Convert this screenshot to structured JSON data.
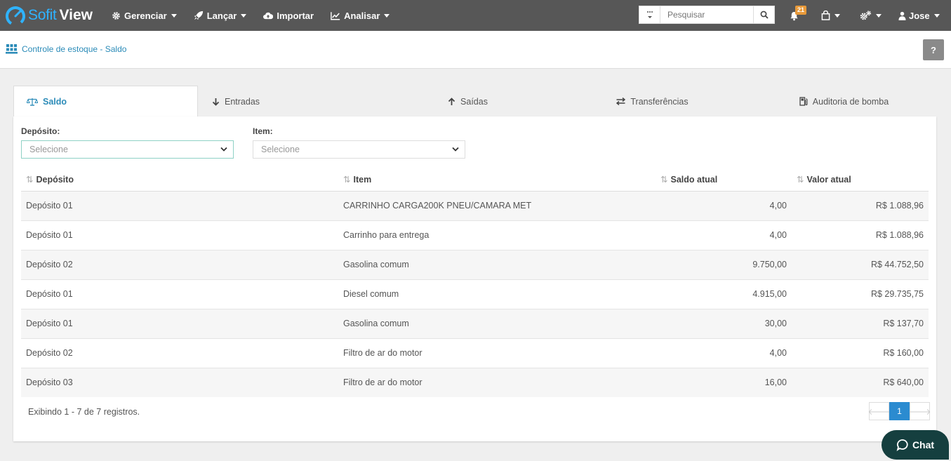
{
  "app": {
    "logo_part1": "Sofit",
    "logo_part2": "View"
  },
  "nav": {
    "items": [
      {
        "label": "Gerenciar",
        "icon": "gear-icon",
        "has_caret": true
      },
      {
        "label": "Lançar",
        "icon": "rocket-icon",
        "has_caret": true
      },
      {
        "label": "Importar",
        "icon": "cloud-upload-icon",
        "has_caret": false
      },
      {
        "label": "Analisar",
        "icon": "line-chart-icon",
        "has_caret": true
      }
    ],
    "search_placeholder": "Pesquisar",
    "notification_count": "21",
    "user_name": "Jose"
  },
  "breadcrumb": {
    "label": "Controle de estoque - Saldo",
    "help_label": "?"
  },
  "tabs": [
    {
      "label": "Saldo",
      "icon": "balance-scale-icon",
      "active": true
    },
    {
      "label": "Entradas",
      "icon": "arrow-down-icon",
      "active": false
    },
    {
      "label": "Saídas",
      "icon": "arrow-up-icon",
      "active": false
    },
    {
      "label": "Transferências",
      "icon": "exchange-icon",
      "active": false
    },
    {
      "label": "Auditoria de bomba",
      "icon": "fuel-pump-icon",
      "active": false
    }
  ],
  "filters": {
    "deposito_label": "Depósito:",
    "deposito_placeholder": "Selecione",
    "item_label": "Item:",
    "item_placeholder": "Selecione"
  },
  "table": {
    "headers": [
      "Depósito",
      "Item",
      "Saldo atual",
      "Valor atual"
    ],
    "rows": [
      [
        "Depósito 01",
        "CARRINHO CARGA200K PNEU/CAMARA MET",
        "4,00",
        "R$ 1.088,96"
      ],
      [
        "Depósito 01",
        "Carrinho para entrega",
        "4,00",
        "R$ 1.088,96"
      ],
      [
        "Depósito 02",
        "Gasolina comum",
        "9.750,00",
        "R$ 44.752,50"
      ],
      [
        "Depósito 01",
        "Diesel comum",
        "4.915,00",
        "R$ 29.735,75"
      ],
      [
        "Depósito 01",
        "Gasolina comum",
        "30,00",
        "R$ 137,70"
      ],
      [
        "Depósito 02",
        "Filtro de ar do motor",
        "4,00",
        "R$ 160,00"
      ],
      [
        "Depósito 03",
        "Filtro de ar do motor",
        "16,00",
        "R$ 640,00"
      ]
    ]
  },
  "footer": {
    "info": "Exibindo 1 - 7 de 7 registros.",
    "current_page": "1",
    "prev_label": "🡐",
    "next_label": "🡒"
  },
  "chat": {
    "label": "Chat"
  },
  "colors": {
    "topbar": "#575757",
    "accent": "#2b8bb8",
    "logo_blue": "#2fb3ff",
    "chat_bg": "#153f3f",
    "badge": "#e89a3a"
  }
}
